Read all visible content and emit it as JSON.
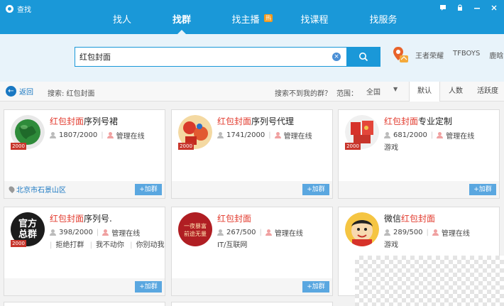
{
  "window": {
    "title": "查找"
  },
  "nav": {
    "tabs": [
      "找人",
      "找群",
      "找主播",
      "找课程",
      "找服务"
    ],
    "active_index": 1,
    "hot_badge": "热"
  },
  "search": {
    "query": "红包封面"
  },
  "hot_words": [
    "王者荣耀",
    "TFBOYS",
    "鹿晗"
  ],
  "filter": {
    "back_label": "返回",
    "breadcrumb": "搜索: 红包封面",
    "not_found": "搜索不到我的群？",
    "range_label": "范围：",
    "range_value": "全国",
    "sort_tabs": [
      "默认",
      "人数",
      "活跃度"
    ],
    "sort_active_index": 0
  },
  "cards": [
    {
      "name_highlight": "红包封面",
      "name_rest": "序列号裙",
      "members": "1807/2000",
      "admin": "管理在线",
      "tags": [],
      "level": "2000",
      "location": "北京市石景山区",
      "join": "+加群"
    },
    {
      "name_highlight": "红包封面",
      "name_rest": "序列号代理",
      "members": "1741/2000",
      "admin": "管理在线",
      "tags": [],
      "level": "2000",
      "location": "",
      "join": "+加群"
    },
    {
      "name_highlight": "红包封面",
      "name_rest": "专业定制",
      "members": "681/2000",
      "admin": "管理在线",
      "tags": [
        "游戏"
      ],
      "level": "2000",
      "location": "",
      "join": "+加群"
    },
    {
      "name_prefix": "",
      "name_highlight": "红包封面",
      "name_rest": "序列号.",
      "members": "398/2000",
      "admin": "管理在线",
      "tags": [
        "拒绝打群",
        "我不动你",
        "你别动我"
      ],
      "level": "2000",
      "location": "",
      "join": "+加群"
    },
    {
      "name_highlight": "红包封面",
      "name_rest": "",
      "members": "267/500",
      "admin": "管理在线",
      "tags": [
        "IT/互联网"
      ],
      "level": "",
      "location": "",
      "join": "+加群"
    },
    {
      "name_prefix": "微信",
      "name_highlight": "红包封面",
      "name_rest": "",
      "members": "289/500",
      "admin": "管理在线",
      "tags": [
        "游戏"
      ],
      "level": "",
      "location": "",
      "join": ""
    }
  ],
  "avatar_text": {
    "card4": [
      "官方",
      "总群"
    ],
    "card5": [
      "一夜暴富",
      "前途无量"
    ]
  },
  "colors": {
    "brand_blue": "#1a98d8",
    "highlight_red": "#e23b2e",
    "join_blue": "#5aa7e0"
  }
}
